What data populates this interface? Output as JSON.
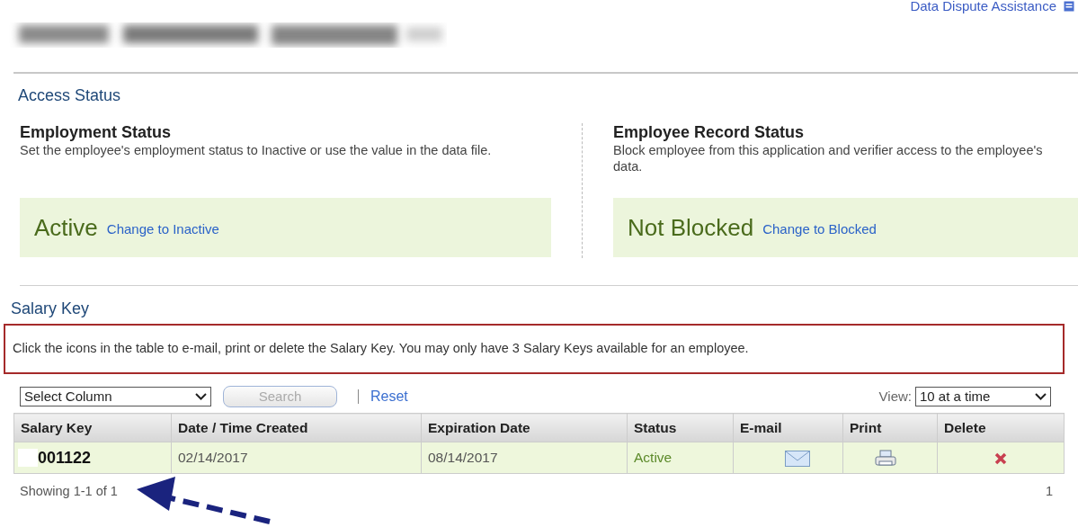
{
  "header": {
    "link": "Data Dispute Assistance"
  },
  "access_status": {
    "title": "Access Status",
    "panels": [
      {
        "heading": "Employment Status",
        "description": "Set the employee's employment status to Inactive or use the value in the data file.",
        "value": "Active",
        "action": "Change to Inactive"
      },
      {
        "heading": "Employee Record Status",
        "description": "Block employee from this application and verifier access to the employee's data.",
        "value": "Not Blocked",
        "action": "Change to Blocked"
      }
    ]
  },
  "salary_key": {
    "title": "Salary Key",
    "notice": "Click the icons in the table to e-mail, print or delete the Salary Key. You may only have 3 Salary Keys available for an employee.",
    "column_select": "Select Column",
    "search_button": "Search",
    "reset_link": "Reset",
    "view_label": "View:",
    "view_select": "10 at a time",
    "table": {
      "columns": [
        "Salary Key",
        "Date / Time Created",
        "Expiration Date",
        "Status",
        "E-mail",
        "Print",
        "Delete"
      ],
      "rows": [
        {
          "salary_key": "001122",
          "created": "02/14/2017",
          "expiration": "08/14/2017",
          "status": "Active"
        }
      ]
    },
    "showing": "Showing 1-1 of 1",
    "page": "1"
  }
}
